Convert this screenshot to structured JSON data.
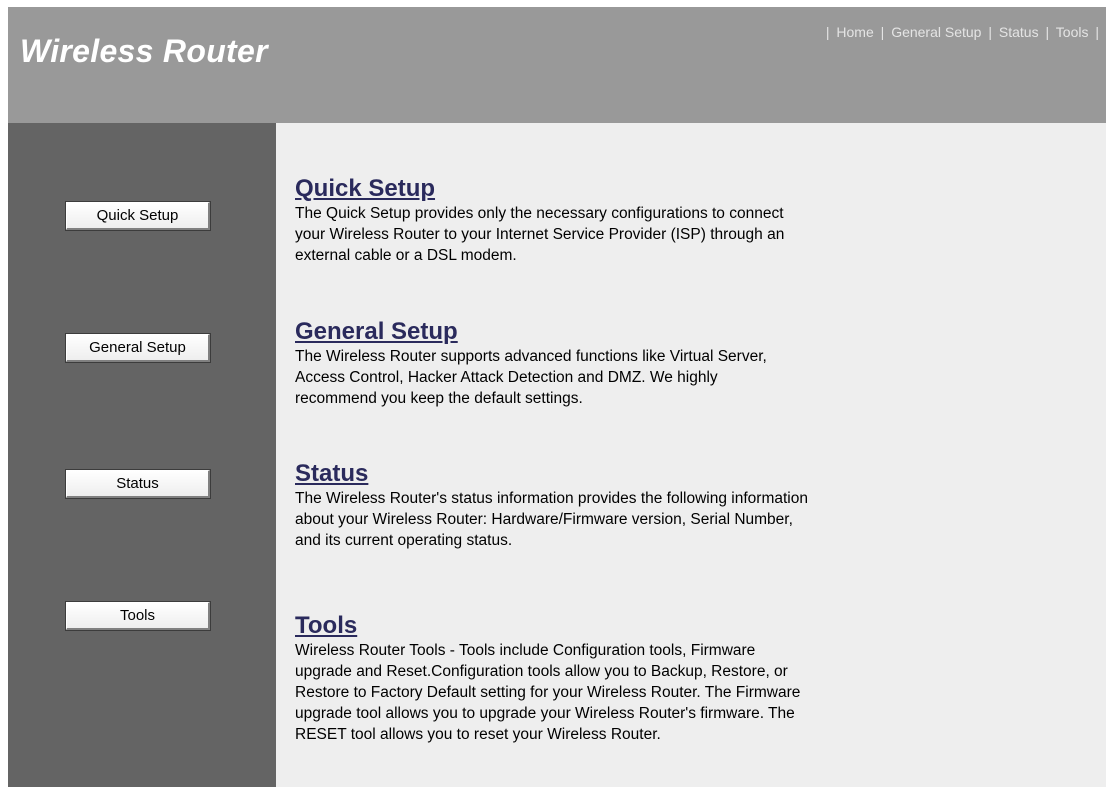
{
  "header": {
    "title": "Wireless Router",
    "nav": [
      {
        "label": "Home"
      },
      {
        "label": "General Setup"
      },
      {
        "label": "Status"
      },
      {
        "label": "Tools"
      }
    ],
    "separator": "|"
  },
  "sidebar": {
    "buttons": [
      {
        "label": "Quick Setup"
      },
      {
        "label": "General Setup"
      },
      {
        "label": "Status"
      },
      {
        "label": "Tools"
      }
    ]
  },
  "main": {
    "sections": [
      {
        "title": "Quick Setup",
        "lines": [
          "The Quick Setup provides only the necessary configurations to connect",
          "your Wireless Router to your Internet Service Provider (ISP) through an",
          "external cable or a DSL modem."
        ]
      },
      {
        "title": "General Setup",
        "lines": [
          "The Wireless Router supports advanced functions like Virtual Server,",
          "Access Control, Hacker Attack Detection and DMZ. We highly",
          "recommend you keep the default settings."
        ]
      },
      {
        "title": "Status",
        "lines": [
          "The Wireless Router's status information provides the following information",
          "about your Wireless Router: Hardware/Firmware version, Serial Number,",
          "and its current operating status."
        ]
      },
      {
        "title": "Tools",
        "lines": [
          "Wireless Router Tools - Tools include Configuration tools, Firmware",
          "upgrade and Reset.Configuration tools allow you to Backup, Restore, or",
          "Restore to Factory Default setting for your Wireless Router. The Firmware",
          "upgrade tool allows you to upgrade your Wireless Router's firmware. The",
          "RESET tool allows you to reset your Wireless Router."
        ]
      }
    ]
  },
  "colors": {
    "header_bg": "#999999",
    "sidebar_bg": "#646464",
    "content_bg": "#eeeeee",
    "section_title": "#2a2a5c"
  }
}
